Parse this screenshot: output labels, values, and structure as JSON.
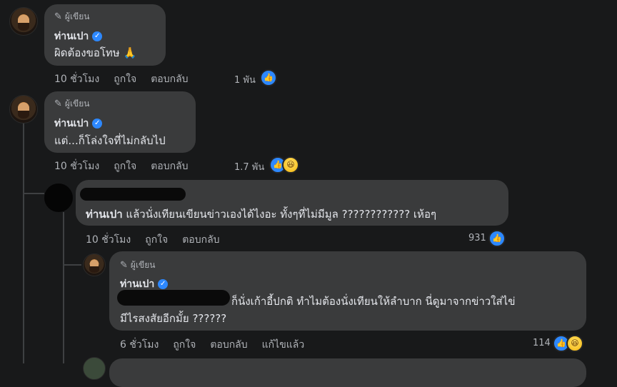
{
  "comments": [
    {
      "author_tag": "ผู้เขียน",
      "name": "ท่านเปา",
      "text": "ผิดต้องขอโทษ 🙏",
      "time": "10 ชั่วโมง",
      "like": "ถูกใจ",
      "reply": "ตอบกลับ",
      "reactions": "1 พัน"
    },
    {
      "author_tag": "ผู้เขียน",
      "name": "ท่านเปา",
      "text": "แต่...ก็โล่งใจที่ไม่กลับไป",
      "time": "10 ชั่วโมง",
      "like": "ถูกใจ",
      "reply": "ตอบกลับ",
      "reactions": "1.7 พัน"
    },
    {
      "mention": "ท่านเปา",
      "text": " แล้วนั่งเทียนเขียนข่าวเองได้ไงอะ ทั้งๆที่ไม่มีมูล ???????????? เห้อๆ",
      "time": "10 ชั่วโมง",
      "like": "ถูกใจ",
      "reply": "ตอบกลับ",
      "reactions": "931"
    },
    {
      "author_tag": "ผู้เขียน",
      "name": "ท่านเปา",
      "text_line1": "ก็นั่งเก้าอี้ปกติ ทำไมต้องนั่งเทียนให้ลำบาก นี่ดูมาจากข่าวใส่ไข่",
      "text_line2": "มีไรสงสัยอีกมั้ย ??????",
      "time": "6 ชั่วโมง",
      "like": "ถูกใจ",
      "reply": "ตอบกลับ",
      "edited": "แก้ไขแล้ว",
      "reactions": "114"
    }
  ],
  "icons": {
    "verified": "verified-badge-icon",
    "pencil": "pencil-icon",
    "like": "like-reaction-icon",
    "haha": "haha-reaction-icon"
  },
  "colors": {
    "background": "#18191a",
    "bubble": "#3a3b3c",
    "accent": "#2d88ff"
  }
}
